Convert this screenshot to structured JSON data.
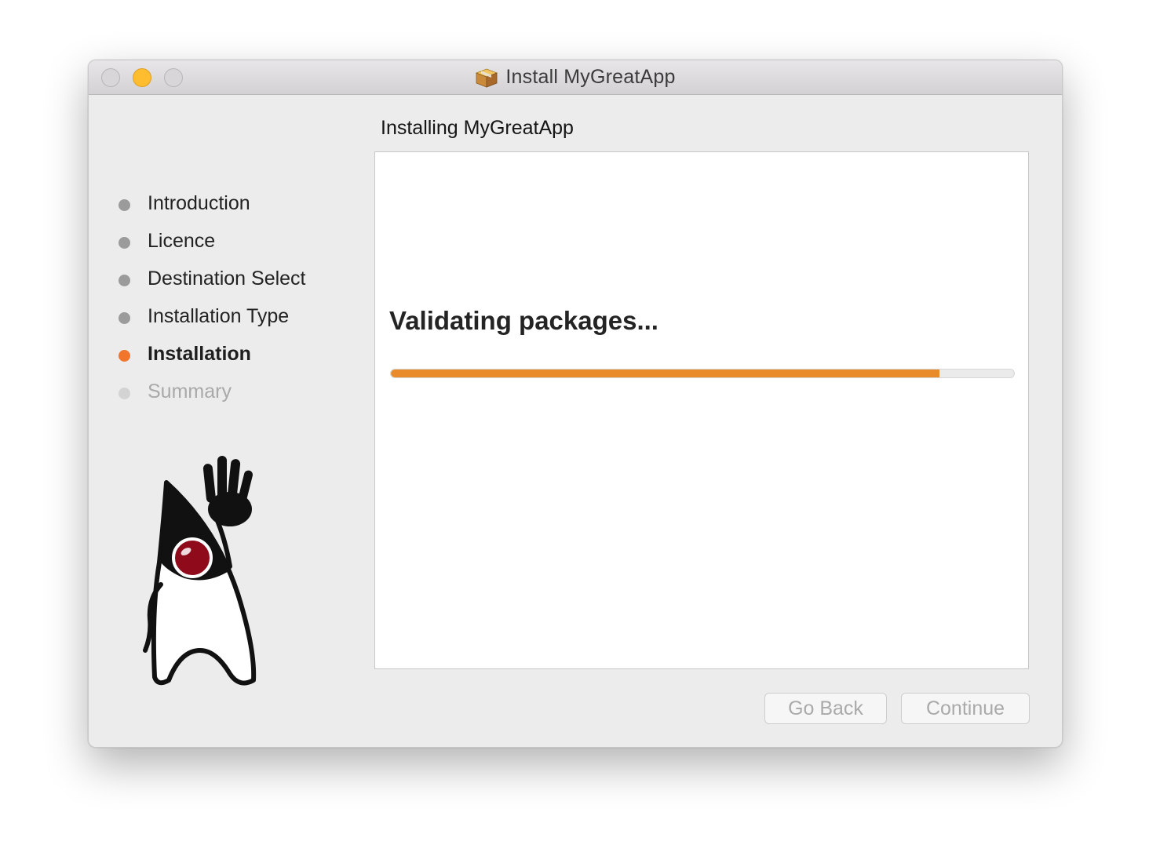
{
  "window": {
    "title": "Install MyGreatApp",
    "app_icon": "package-icon"
  },
  "pane": {
    "title": "Installing MyGreatApp"
  },
  "sidebar": {
    "steps": [
      {
        "label": "Introduction",
        "state": "done"
      },
      {
        "label": "Licence",
        "state": "done"
      },
      {
        "label": "Destination Select",
        "state": "done"
      },
      {
        "label": "Installation Type",
        "state": "done"
      },
      {
        "label": "Installation",
        "state": "current"
      },
      {
        "label": "Summary",
        "state": "future"
      }
    ],
    "illustration": "java-duke-mascot"
  },
  "content": {
    "status_text": "Validating packages...",
    "progress_fraction": 0.88
  },
  "buttons": {
    "go_back": "Go Back",
    "continue": "Continue"
  },
  "colors": {
    "accent": "#e98b2a",
    "current_step_dot": "#f0762e"
  }
}
